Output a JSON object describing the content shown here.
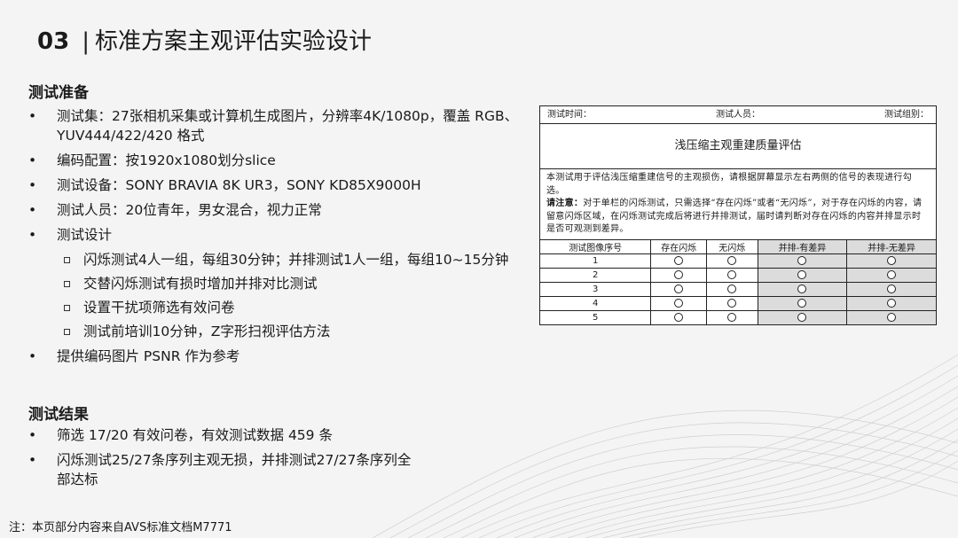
{
  "title": {
    "number": "03",
    "separator": "|",
    "text": "标准方案主观评估实验设计"
  },
  "prep": {
    "heading": "测试准备",
    "items": [
      {
        "text": "测试集：27张相机采集或计算机生成图片，分辨率4K/1080p，覆盖 RGB、YUV444/422/420 格式"
      },
      {
        "text": "编码配置：按1920x1080划分slice"
      },
      {
        "text": "测试设备：SONY BRAVIA 8K UR3，SONY KD85X9000H"
      },
      {
        "text": "测试人员：20位青年，男女混合，视力正常"
      },
      {
        "text": "测试设计"
      }
    ],
    "sub_items": [
      "闪烁测试4人一组，每组30分钟；并排测试1人一组，每组10~15分钟",
      "交替闪烁测试有损时增加并排对比测试",
      "设置干扰项筛选有效问卷",
      "测试前培训10分钟，Z字形扫视评估方法"
    ],
    "last_item": "提供编码图片 PSNR 作为参考"
  },
  "results": {
    "heading": "测试结果",
    "items": [
      "筛选 17/20 有效问卷，有效测试数据 459 条",
      "闪烁测试25/27条序列主观无损，并排测试27/27条序列全部达标"
    ]
  },
  "bullet_symbol": "•",
  "footnote": "注：本页部分内容来自AVS标准文档M7771",
  "form": {
    "time_label": "测试时间：",
    "person_label": "测试人员：",
    "group_label": "测试组别：",
    "title": "浅压缩主观重建质量评估",
    "intro": "本测试用于评估浅压缩重建信号的主观损伤，请根据屏幕显示左右两侧的信号的表现进行勾选。",
    "note_label": "请注意：",
    "note": "对于单栏的闪烁测试，只需选择“存在闪烁”或者“无闪烁”，对于存在闪烁的内容，请留意闪烁区域，在闪烁测试完成后将进行并排测试，届时请判断对存在闪烁的内容并排显示时是否可观测到差异。",
    "columns": [
      "测试图像序号",
      "存在闪烁",
      "无闪烁",
      "并排-有差异",
      "并排-无差异"
    ],
    "rows": [
      "1",
      "2",
      "3",
      "4",
      "5"
    ]
  }
}
